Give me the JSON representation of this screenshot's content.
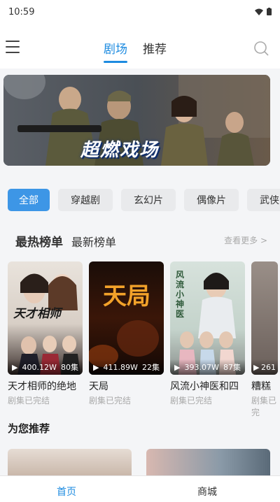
{
  "status_bar": {
    "time": "10:59"
  },
  "top_nav": {
    "tabs": [
      {
        "label": "剧场",
        "active": true
      },
      {
        "label": "推荐",
        "active": false
      }
    ]
  },
  "banner": {
    "title": "超燃戏场"
  },
  "categories": [
    {
      "label": "全部",
      "active": true
    },
    {
      "label": "穿越剧",
      "active": false
    },
    {
      "label": "玄幻片",
      "active": false
    },
    {
      "label": "偶像片",
      "active": false
    },
    {
      "label": "武侠",
      "active": false
    }
  ],
  "ranking": {
    "tabs": [
      "最热榜单",
      "最新榜单"
    ],
    "see_more": "查看更多 >",
    "items": [
      {
        "title": "天才相师的绝地",
        "views": "400.12W",
        "episodes": "80集",
        "status": "剧集已完结",
        "poster_text": "天才相师"
      },
      {
        "title": "天局",
        "views": "411.89W",
        "episodes": "22集",
        "status": "剧集已完结",
        "poster_text": "天局"
      },
      {
        "title": "风流小神医和四",
        "views": "393.07W",
        "episodes": "87集",
        "status": "剧集已完结",
        "poster_text": "风流小神医"
      },
      {
        "title": "糟糕",
        "views": "261",
        "episodes": "",
        "status": "剧集已完",
        "poster_text": ""
      }
    ]
  },
  "recommend": {
    "title": "为您推荐"
  },
  "bottom_nav": {
    "items": [
      {
        "label": "首页",
        "active": true
      },
      {
        "label": "商城",
        "active": false
      }
    ]
  },
  "colors": {
    "accent": "#1d8be0",
    "chip_active": "#3d96e6"
  }
}
